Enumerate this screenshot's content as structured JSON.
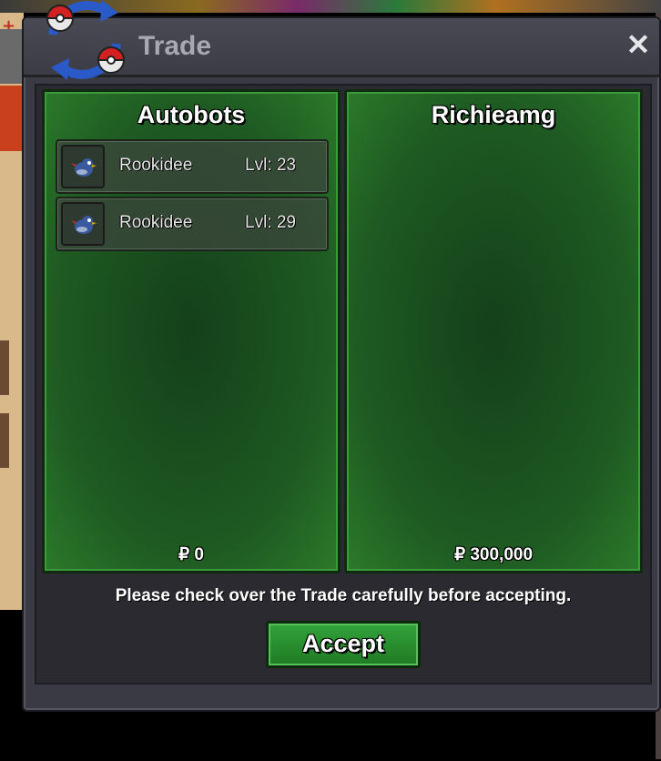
{
  "window": {
    "title": "Trade",
    "close_icon": "close-icon",
    "logo_icon": "trade-pokeballs-icon"
  },
  "left_panel": {
    "name": "Autobots",
    "items": [
      {
        "pokemon": "Rookidee",
        "level": "Lvl: 23",
        "icon": "rookidee-sprite-icon"
      },
      {
        "pokemon": "Rookidee",
        "level": "Lvl: 29",
        "icon": "rookidee-sprite-icon"
      }
    ],
    "money": "₽ 0"
  },
  "right_panel": {
    "name": "Richieamg",
    "items": [],
    "money": "₽ 300,000"
  },
  "notice": "Please check over the Trade carefully before accepting.",
  "accept_label": "Accept",
  "colors": {
    "panel_green": "#1e5a22",
    "window_gray": "#3a3a44",
    "accept_green": "#2a8e2f"
  }
}
